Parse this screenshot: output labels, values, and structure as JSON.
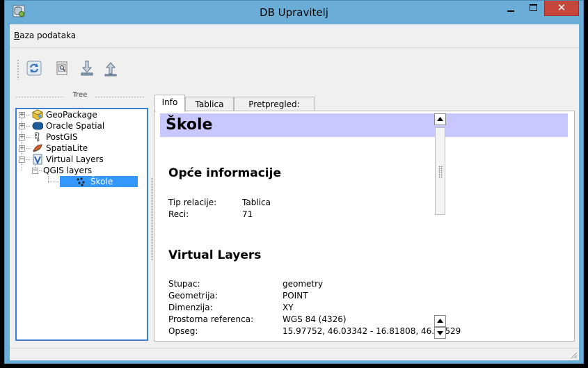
{
  "window": {
    "title": "DB Upravitelj"
  },
  "menubar": {
    "items": [
      {
        "accel": "B",
        "rest": "aza podataka"
      }
    ]
  },
  "tree": {
    "header": "Tree",
    "items": [
      {
        "label": "GeoPackage"
      },
      {
        "label": "Oracle Spatial"
      },
      {
        "label": "PostGIS"
      },
      {
        "label": "SpatiaLite"
      },
      {
        "label": "Virtual Layers"
      },
      {
        "label": "QGIS layers"
      },
      {
        "label": "Škole"
      }
    ]
  },
  "tabs": [
    {
      "label": "Info"
    },
    {
      "label": "Tablica"
    },
    {
      "label": "Pretpregled:"
    }
  ],
  "info": {
    "title": "Škole",
    "general": {
      "title": "Opće informacije",
      "rows": [
        {
          "key": "Tip relacije:",
          "value": "Tablica"
        },
        {
          "key": "Reci:",
          "value": "71"
        }
      ]
    },
    "virtual": {
      "title": "Virtual Layers",
      "rows": [
        {
          "key": "Stupac:",
          "value": "geometry"
        },
        {
          "key": "Geometrija:",
          "value": "POINT"
        },
        {
          "key": "Dimenzija:",
          "value": "XY"
        },
        {
          "key": "Prostorna referenca:",
          "value": "WGS 84 (4326)"
        },
        {
          "key": "Opseg:",
          "value": "15.97752, 46.03342 - 16.81808, 46.52529"
        }
      ]
    }
  },
  "colors": {
    "selection": "#3399ff",
    "heading_bg": "#c8c8ff",
    "titlebar": "#6aaed8",
    "close_button": "#c7463c"
  },
  "icons": {
    "app": "database-icon",
    "refresh": "refresh-icon",
    "sql": "sql-window-icon",
    "import": "import-layer-icon",
    "export": "export-icon"
  }
}
